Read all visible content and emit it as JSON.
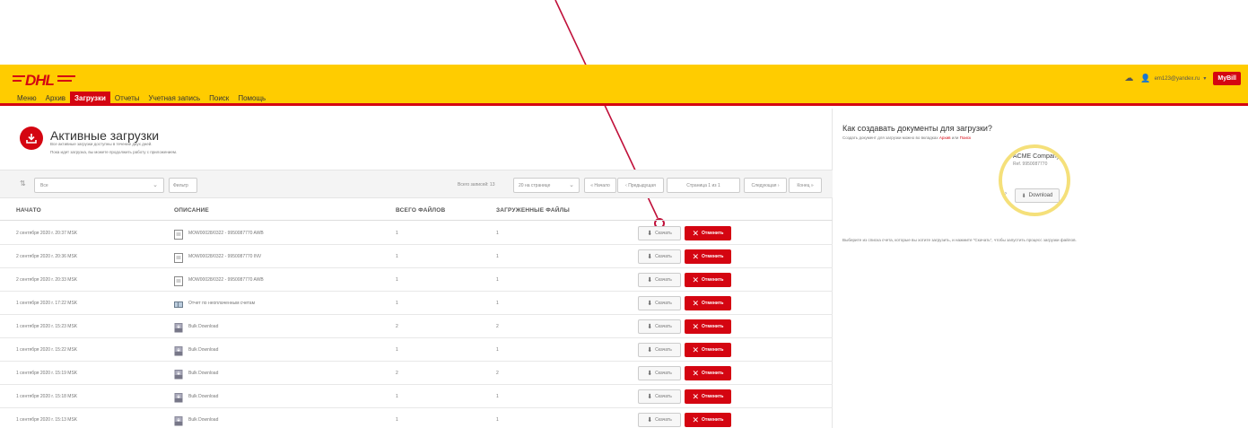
{
  "header": {
    "logo_text": "DHL",
    "nav": [
      {
        "label": "Меню",
        "active": false
      },
      {
        "label": "Архив",
        "active": false
      },
      {
        "label": "Загрузки",
        "active": true
      },
      {
        "label": "Отчеты",
        "active": false
      },
      {
        "label": "Учетная запись",
        "active": false
      },
      {
        "label": "Поиск",
        "active": false
      },
      {
        "label": "Помощь",
        "active": false
      }
    ],
    "user_email": "em123@yandex.ru",
    "mybill_label": "MyBill",
    "colors": {
      "brand_yellow": "#ffcc00",
      "brand_red": "#d40511"
    }
  },
  "main": {
    "title": "Активные загрузки",
    "subtitle_1": "Все активные загрузки доступны в течение двух дней.",
    "subtitle_2": "Пока идет загрузка, вы можете продолжить работу с приложением.",
    "toolbar": {
      "select_value": "Все",
      "filter_label": "Фильтр",
      "total_label": "Всего записей: 13",
      "per_page_value": "20 на странице",
      "first_label": "« Начало",
      "prev_label": "‹ Предыдущая",
      "page_label": "Страница 1 из 1",
      "next_label": "Следующая ›",
      "last_label": "Конец »"
    },
    "columns": [
      "НАЧАТО",
      "ОПИСАНИЕ",
      "ВСЕГО ФАЙЛОВ",
      "ЗАГРУЖЕННЫЕ ФАЙЛЫ"
    ],
    "download_label": "Скачать",
    "cancel_label": "Отменить",
    "rows": [
      {
        "started": "2 сентября 2020 г. 20:37 MSK",
        "description": "MOW00028/0322 - 9950087770 AWB",
        "icon": "document-icon",
        "total": "1",
        "loaded": "1"
      },
      {
        "started": "2 сентября 2020 г. 20:36 MSK",
        "description": "MOW00028/0322 - 9950087770 INV",
        "icon": "document-icon",
        "total": "1",
        "loaded": "1"
      },
      {
        "started": "2 сентября 2020 г. 20:33 MSK",
        "description": "MOW00028/0322 - 9950087770 AWB",
        "icon": "document-icon",
        "total": "1",
        "loaded": "1"
      },
      {
        "started": "1 сентября 2020 г. 17:22 MSK",
        "description": "Отчет по неоплаченным счетам",
        "icon": "report-icon",
        "total": "1",
        "loaded": "1"
      },
      {
        "started": "1 сентября 2020 г. 15:23 MSK",
        "description": "Bulk Download",
        "icon": "bulk-download-icon",
        "total": "2",
        "loaded": "2"
      },
      {
        "started": "1 сентября 2020 г. 15:22 MSK",
        "description": "Bulk Download",
        "icon": "bulk-download-icon",
        "total": "1",
        "loaded": "1"
      },
      {
        "started": "1 сентября 2020 г. 15:19 MSK",
        "description": "Bulk Download",
        "icon": "bulk-download-icon",
        "total": "2",
        "loaded": "2"
      },
      {
        "started": "1 сентября 2020 г. 15:18 MSK",
        "description": "Bulk Download",
        "icon": "bulk-download-icon",
        "total": "1",
        "loaded": "1"
      },
      {
        "started": "1 сентября 2020 г. 15:13 MSK",
        "description": "Bulk Download",
        "icon": "bulk-download-icon",
        "total": "1",
        "loaded": "1"
      }
    ]
  },
  "side": {
    "title": "Как создавать документы для загрузки?",
    "sub_prefix": "Создать документ для загрузки можно во вкладках",
    "link_archive": "Архив",
    "sub_or": "или",
    "link_search": "Поиск",
    "zoom_company": "ACME Company",
    "zoom_ref": "Ref. 9950087770",
    "zoom_download": "Download",
    "hint": "Выберите из списка счета, которые вы хотите загрузить, и нажмите \"Скачать\", чтобы запустить процесс загрузки файлов."
  }
}
